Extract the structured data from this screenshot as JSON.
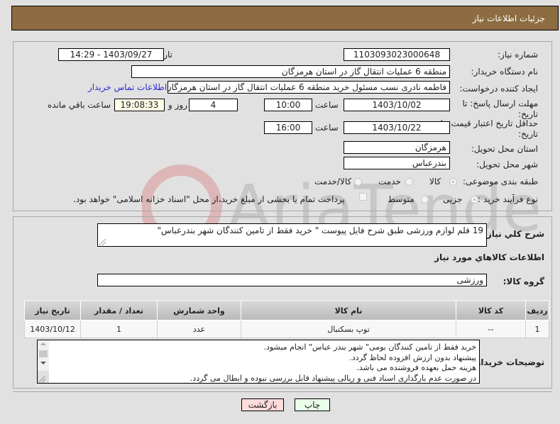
{
  "header": {
    "title": "جزئیات اطلاعات نیاز"
  },
  "form": {
    "need_number": {
      "label": "شماره نیاز:",
      "value": "1103093023000648"
    },
    "announce_datetime": {
      "label": "تاریخ و ساعت اعلان عمومی:",
      "value": "1403/09/27 - 14:29"
    },
    "buyer_org": {
      "label": "نام دستگاه خریدار:",
      "value": "منطقه 6 عملیات انتقال گاز در استان هرمزگان"
    },
    "requester": {
      "label": "ایجاد کننده درخواست:",
      "value": "فاطمه نادری نسب مسئول خرید منطقه 6 عملیات انتقال گاز در استان هرمزگان",
      "contact_link": "اطلاعات تماس خریدار"
    },
    "reply_deadline": {
      "label": "مهلت ارسال پاسخ: تا تاریخ:",
      "date": "1403/10/02",
      "time_label": "ساعت",
      "time": "10:00",
      "days": "4",
      "days_label": "روز و",
      "remaining": "19:08:33",
      "remaining_label": "ساعت باقي مانده"
    },
    "price_validity": {
      "label": "حداقل تاریخ اعتبار قیمت: تا تاریخ:",
      "date": "1403/10/22",
      "time_label": "ساعت",
      "time": "16:00"
    },
    "delivery_province": {
      "label": "استان محل تحویل:",
      "value": "هرمزگان"
    },
    "delivery_city": {
      "label": "شهر محل تحویل:",
      "value": "بندرعباس"
    },
    "category": {
      "label": "طبقه بندی موضوعی:",
      "options": [
        "کالا",
        "خدمت",
        "کالا/خدمت"
      ],
      "selected": "کالا"
    },
    "process_type": {
      "label": "نوع فرآیند خرید :",
      "options": [
        "جزیی",
        "متوسط"
      ],
      "selected": "جزیی",
      "treasury_note": "پرداخت تمام یا بخشی از مبلغ خرید،از محل \"اسناد خزانه اسلامی\" خواهد بود."
    }
  },
  "description": {
    "label": "شرح کلي نياز:",
    "value": "19 قلم لوازم ورزشی طبق شرح فایل پیوست \" خرید فقط از تامین کنندگان شهر بندرعباس\""
  },
  "goods_section": {
    "title": "اطلاعات کالاهاي مورد نياز",
    "group_label": "گروه کالا:",
    "group_value": "ورزشی",
    "table": {
      "headers": [
        "ردیف",
        "کد کالا",
        "نام کالا",
        "واحد شمارش",
        "تعداد / مقدار",
        "تاریخ نیاز"
      ],
      "rows": [
        [
          "1",
          "--",
          "توپ بسکتبال",
          "عدد",
          "1",
          "1403/10/12"
        ]
      ]
    }
  },
  "buyer_notes": {
    "label": "توضیحات خریدار:",
    "lines": [
      "خرید فقط از تامین کنندگان  بومی\" شهر بندر عباس\" انجام میشود.",
      "پیشنهاد بدون ارزش افزوده لحاظ گردد.",
      "هزینه حمل بعهده فروشنده می باشد.",
      "در صورت عدم بارگذاری اسناد فنی و ریالی پیشنهاد قابل بررسی نبوده و ابطال می گردد."
    ]
  },
  "buttons": {
    "print": "چاپ",
    "back": "بازگشت"
  },
  "colors": {
    "header_bg": "#8d6c41",
    "print_bg": "#eaffea",
    "back_bg": "#ffdcdc",
    "link": "#2b2bd6"
  },
  "watermark": "AriaTender.net"
}
